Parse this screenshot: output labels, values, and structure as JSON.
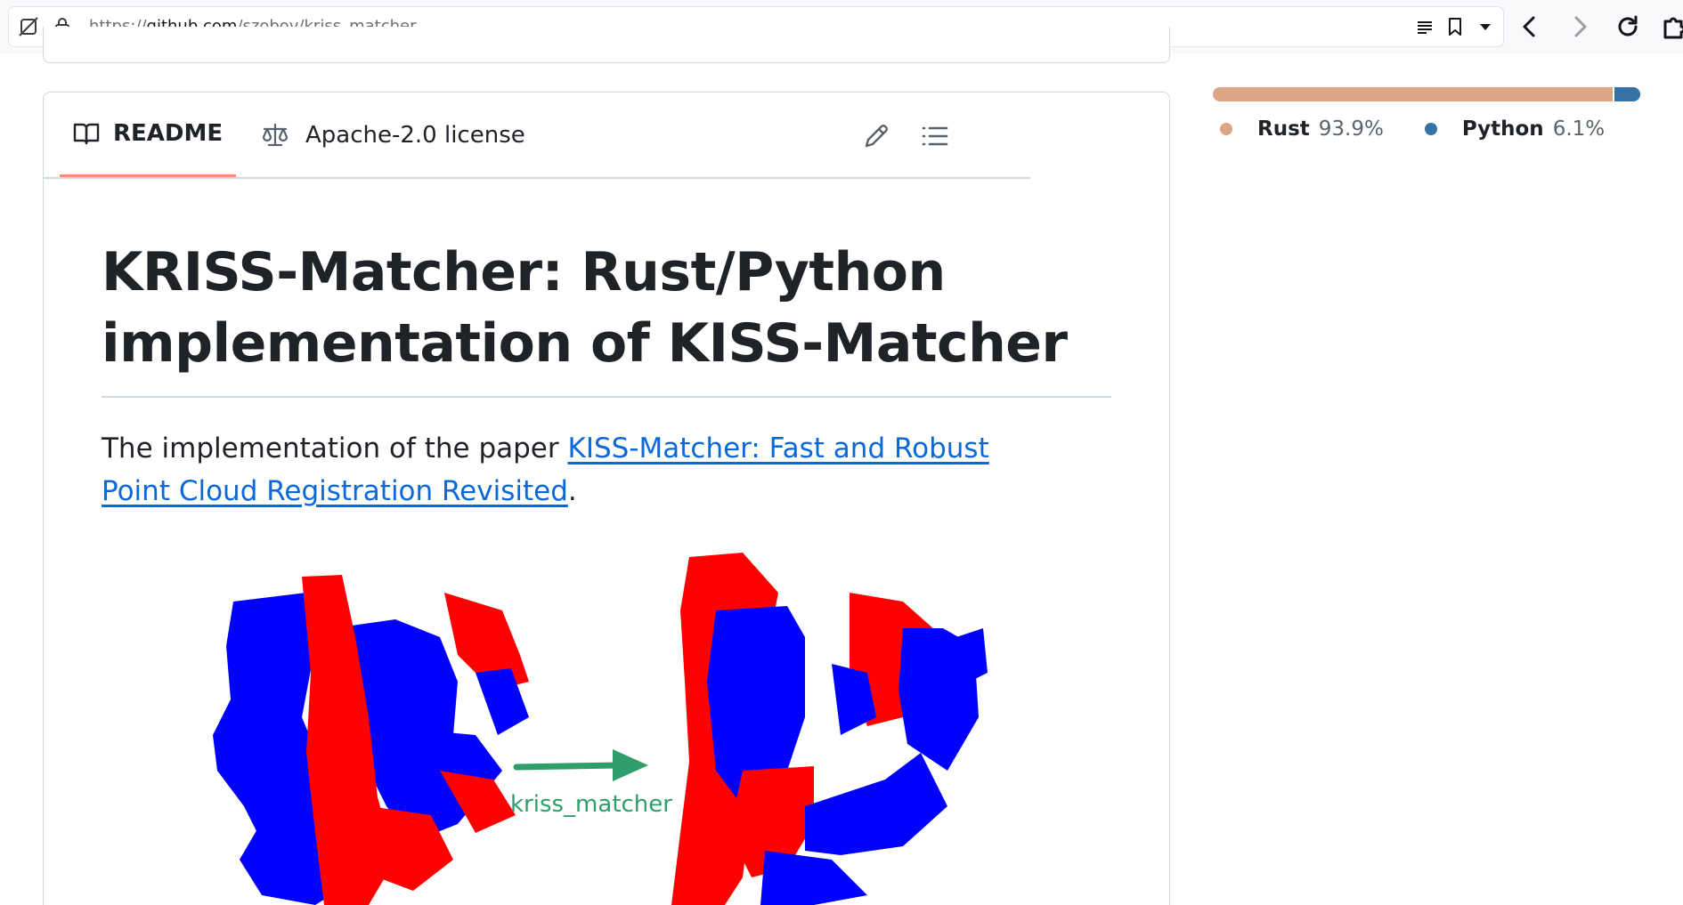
{
  "browser": {
    "url_scheme": "https://",
    "url_host": "github.com",
    "url_path": "/szobov/kriss_matcher"
  },
  "readme": {
    "tab_readme_label": "README",
    "tab_license_label": "Apache-2.0 license",
    "title": "KRISS-Matcher: Rust/Python implementation of KISS-Matcher",
    "intro_prefix": "The implementation of the paper ",
    "paper_link": "KISS-Matcher: Fast and Robust Point Cloud Registration Revisited",
    "intro_suffix": ".",
    "figure": {
      "arrow_label": "kriss_matcher",
      "arrow_color": "#2e9e6a",
      "source_color": "#ff0000",
      "target_color": "#0000ff"
    }
  },
  "languages": [
    {
      "name": "Rust",
      "percent": "93.9%",
      "share": 93.9,
      "color": "#dea584"
    },
    {
      "name": "Python",
      "percent": "6.1%",
      "share": 6.1,
      "color": "#3572A5"
    }
  ]
}
